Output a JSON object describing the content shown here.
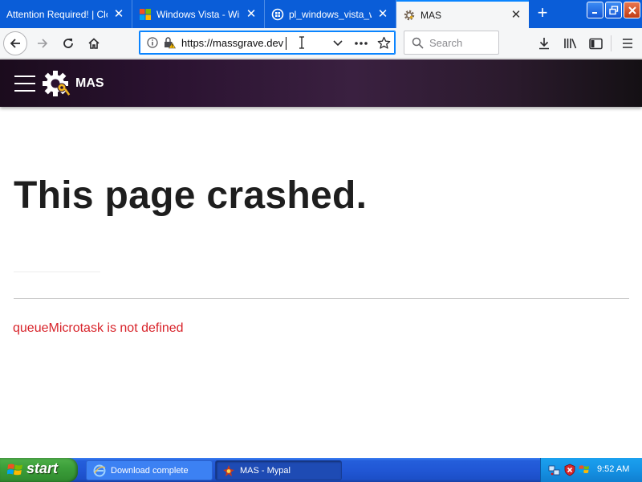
{
  "tabs": [
    {
      "title": "Attention Required! | Clo",
      "icon": "none",
      "active": false
    },
    {
      "title": "Windows Vista - Wind",
      "icon": "windows-logo-icon",
      "active": false
    },
    {
      "title": "pl_windows_vista_wi",
      "icon": "generic-page-icon",
      "active": false
    },
    {
      "title": "MAS",
      "icon": "gear-icon",
      "active": true
    }
  ],
  "toolbar": {
    "url": "https://massgrave.dev",
    "search_placeholder": "Search"
  },
  "site": {
    "brand": "MAS"
  },
  "page": {
    "heading": "This page crashed.",
    "error": "queueMicrotask is not defined"
  },
  "taskbar": {
    "start_label": "start",
    "items": [
      {
        "label": "Download complete"
      },
      {
        "label": "MAS - Mypal"
      }
    ],
    "clock": "9:52 AM"
  },
  "colors": {
    "tabstrip": "#0a5dd8",
    "error_text": "#d8232a",
    "header_bg": "#2a1230",
    "taskbar_blue": "#245edb",
    "start_green": "#3c9f3a"
  }
}
